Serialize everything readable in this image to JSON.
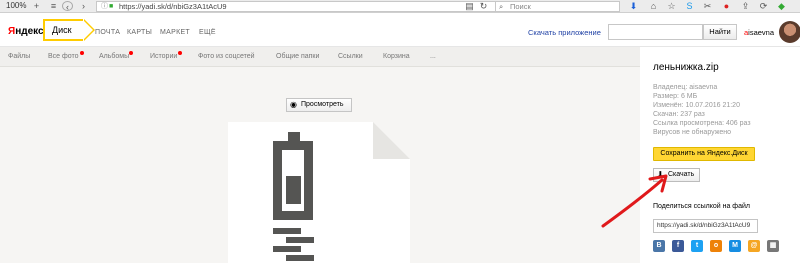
{
  "browser": {
    "zoom": "100%",
    "url": "https://yadi.sk/d/nbiGz3A1tAcU9",
    "search_placeholder": "Поиск"
  },
  "header": {
    "logo_prefix": "Я",
    "logo_rest": "ндекс",
    "disk_label": "Диск",
    "links": [
      "ПОЧТА",
      "КАРТЫ",
      "МАРКЕТ",
      "ЕЩЁ"
    ],
    "app_link": "Скачать приложение",
    "find_button": "Найти",
    "user_first": "a",
    "user_rest": "isaevna"
  },
  "subnav": {
    "items": [
      "Файлы",
      "Все фото",
      "Альбомы",
      "Истории",
      "Фото из соцсетей",
      "Общие папки",
      "Ссылки",
      "Корзина",
      "..."
    ]
  },
  "main": {
    "view_button": "Просмотреть"
  },
  "sidebar": {
    "file_name": "леньнижка.zip",
    "meta": [
      "Владелец: aisaevna",
      "Размер: 6 МБ",
      "Изменён: 10.07.2016 21:20",
      "Скачан: 237 раз",
      "Ссылка просмотрена: 406 раз",
      "Вирусов не обнаружено"
    ],
    "save_button": "Сохранить на Яндекс.Диск",
    "download_button": "Скачать",
    "share_label": "Поделиться ссылкой на файл",
    "share_url": "https://yadi.sk/d/nbiGz3A1tAcU9",
    "social": [
      {
        "label": "В",
        "color": "#4a76a8",
        "icon": "vk-icon"
      },
      {
        "label": "f",
        "color": "#3b5998",
        "icon": "facebook-icon"
      },
      {
        "label": "t",
        "color": "#1da1f2",
        "icon": "twitter-icon"
      },
      {
        "label": "о",
        "color": "#ee8208",
        "icon": "odnoklassniki-icon"
      },
      {
        "label": "М",
        "color": "#168de2",
        "icon": "mailru-icon"
      },
      {
        "label": "@",
        "color": "#f5a623",
        "icon": "email-icon"
      },
      {
        "label": "▦",
        "color": "#777777",
        "icon": "qr-icon"
      }
    ]
  },
  "colors": {
    "accent_yellow": "#ffd633",
    "annotation_red": "#e0191b"
  }
}
